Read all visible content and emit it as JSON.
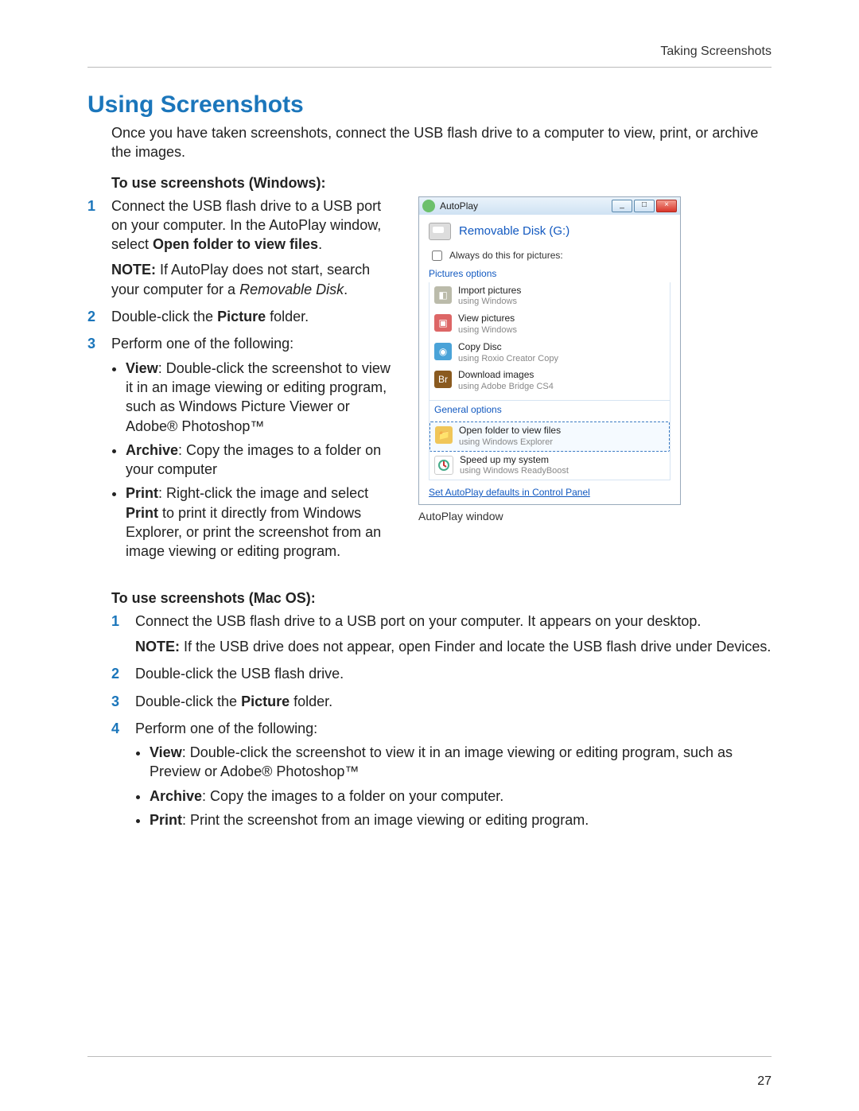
{
  "runningHead": "Taking Screenshots",
  "pageNumber": "27",
  "title": "Using Screenshots",
  "intro": "Once you have taken screenshots, connect the USB flash drive to a computer to view, print, or archive the images.",
  "windows": {
    "heading": "To use screenshots (Windows):",
    "step1a": "Connect the USB flash drive to a USB port on your computer. In the AutoPlay window, select ",
    "step1b_bold": "Open folder to view files",
    "step1c": ".",
    "noteLabel": "NOTE:",
    "noteText": " If AutoPlay does not start, search your computer for a ",
    "noteItalic": "Removable Disk",
    "noteEnd": ".",
    "step2a": "Double-click the ",
    "step2b_bold": "Picture",
    "step2c": " folder.",
    "step3": "Perform one of the following:",
    "bView_bold": "View",
    "bView_text": ": Double-click the screenshot to view it in an image viewing or editing program, such as Windows Picture Viewer or Adobe® Photoshop™",
    "bArchive_bold": "Archive",
    "bArchive_text": ": Copy the images to a folder on your computer",
    "bPrint_bold": "Print",
    "bPrint_text_a": ": Right-click the image and select ",
    "bPrint_text_bold": "Print",
    "bPrint_text_b": " to print it directly from Windows Explorer, or print the screenshot from an image viewing or editing program."
  },
  "mac": {
    "heading": "To use screenshots (Mac OS):",
    "step1": "Connect the USB flash drive to a USB port on your computer. It appears on your desktop.",
    "noteLabel": "NOTE:",
    "noteText": " If the USB drive does not appear, open Finder and locate the USB flash drive under Devices.",
    "step2": "Double-click the USB flash drive.",
    "step3a": "Double-click the ",
    "step3b_bold": "Picture",
    "step3c": " folder.",
    "step4": "Perform one of the following:",
    "bView_bold": "View",
    "bView_text": ": Double-click the screenshot to view it in an image viewing or editing program, such as Preview or Adobe® Photoshop™",
    "bArchive_bold": "Archive",
    "bArchive_text": ": Copy the images to a folder on your computer.",
    "bPrint_bold": "Print",
    "bPrint_text": ": Print the screenshot from an image viewing or editing program."
  },
  "dialog": {
    "title": "AutoPlay",
    "minimize": "_",
    "maximize": "□",
    "close": "×",
    "device": "Removable Disk (G:)",
    "always": "Always do this for pictures:",
    "picturesOptions": "Pictures options",
    "generalOptions": "General options",
    "opt1_main": "Import pictures",
    "opt1_sub": "using Windows",
    "opt2_main": "View pictures",
    "opt2_sub": "using Windows",
    "opt3_main": "Copy Disc",
    "opt3_sub": "using Roxio Creator Copy",
    "opt4_main": "Download images",
    "opt4_sub": "using Adobe Bridge CS4",
    "opt4_badge": "Br",
    "opt5_main": "Open folder to view files",
    "opt5_sub": "using Windows Explorer",
    "opt6_main": "Speed up my system",
    "opt6_sub": "using Windows ReadyBoost",
    "link": "Set AutoPlay defaults in Control Panel",
    "caption": "AutoPlay window"
  },
  "nums": {
    "n1": "1",
    "n2": "2",
    "n3": "3",
    "n4": "4"
  }
}
